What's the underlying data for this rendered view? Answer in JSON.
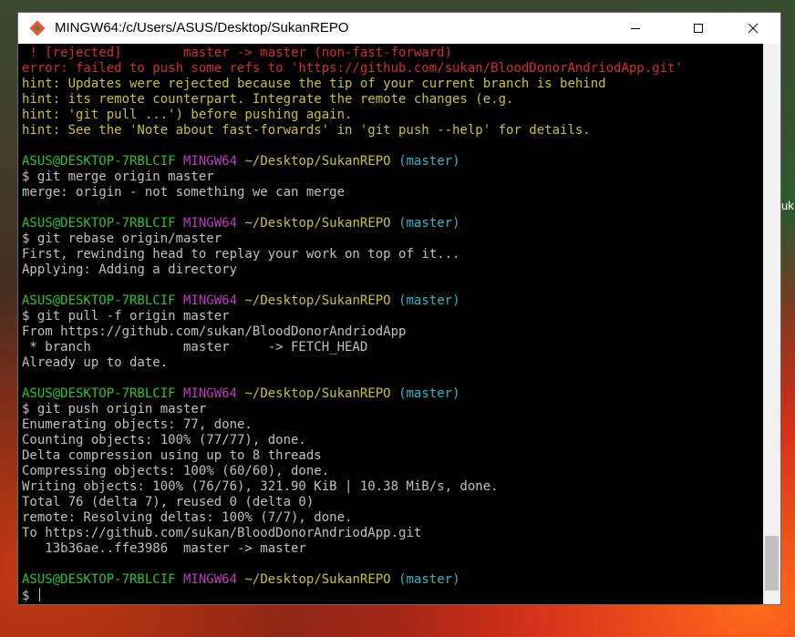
{
  "window": {
    "title": "MINGW64:/c/Users/ASUS/Desktop/SukanREPO"
  },
  "desktop": {
    "peek_text": "uk"
  },
  "prompt": {
    "user": "ASUS@DESKTOP-7RBLCIF",
    "shell": "MINGW64",
    "path": "~/Desktop/SukanREPO",
    "branch": "(master)",
    "symbol": "$ "
  },
  "terminal": {
    "rejected_line": " ! [rejected]        master -> master (non-fast-forward)",
    "error_line": "error: failed to push some refs to 'https://github.com/sukan/BloodDonorAndriodApp.git'",
    "hints": [
      "hint: Updates were rejected because the tip of your current branch is behind",
      "hint: its remote counterpart. Integrate the remote changes (e.g.",
      "hint: 'git pull ...') before pushing again.",
      "hint: See the 'Note about fast-forwards' in 'git push --help' for details."
    ],
    "cmd_merge": "$ git merge origin master",
    "out_merge": "merge: origin - not something we can merge",
    "cmd_rebase": "$ git rebase origin/master",
    "out_rebase": [
      "First, rewinding head to replay your work on top of it...",
      "Applying: Adding a directory"
    ],
    "cmd_pull": "$ git pull -f origin master",
    "out_pull": [
      "From https://github.com/sukan/BloodDonorAndriodApp",
      " * branch            master     -> FETCH_HEAD",
      "Already up to date."
    ],
    "cmd_push": "$ git push origin master",
    "out_push": [
      "Enumerating objects: 77, done.",
      "Counting objects: 100% (77/77), done.",
      "Delta compression using up to 8 threads",
      "Compressing objects: 100% (60/60), done.",
      "Writing objects: 100% (76/76), 321.90 KiB | 10.38 MiB/s, done.",
      "Total 76 (delta 7), reused 0 (delta 0)",
      "remote: Resolving deltas: 100% (7/7), done.",
      "To https://github.com/sukan/BloodDonorAndriodApp.git",
      "   13b36ae..ffe3986  master -> master"
    ]
  },
  "colors": {
    "error": "#d42c2c",
    "hint": "#c8c32c",
    "prompt_user": "#29c42f",
    "prompt_shell": "#c03ac0",
    "prompt_path": "#c8c32c",
    "prompt_branch": "#2fb8c8"
  },
  "icons": {
    "app": "git-diamond-icon",
    "minimize": "minimize-icon",
    "maximize": "maximize-icon",
    "close": "close-icon"
  }
}
